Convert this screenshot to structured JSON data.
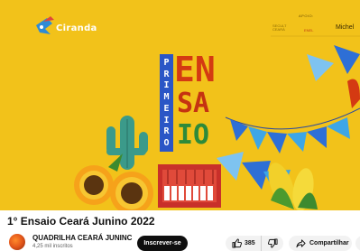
{
  "thumbnail": {
    "logo_text": "Ciranda",
    "sponsor_top": "APOIO:",
    "sponsor_1": "SECULT CEARÁ",
    "sponsor_2": "ENEL",
    "sponsor_3": "Michel",
    "vertical_word": [
      "P",
      "R",
      "I",
      "M",
      "E",
      "I",
      "R",
      "O"
    ],
    "big_line_1": "EN",
    "big_line_2": "SA",
    "big_line_3": "IO",
    "background_color": "#f2c21a"
  },
  "video": {
    "title": "1° Ensaio Ceará Junino 2022"
  },
  "channel": {
    "name": "QUADRILHA CEARÁ JUNINC",
    "subscribers": "4,25 mil inscritos",
    "avatar_icon": "channel-avatar"
  },
  "actions": {
    "subscribe_label": "Inscrever-se",
    "like_count": "385",
    "like_icon": "thumbs-up-icon",
    "dislike_icon": "thumbs-down-icon",
    "share_label": "Compartilhar",
    "share_icon": "share-arrow-icon"
  }
}
